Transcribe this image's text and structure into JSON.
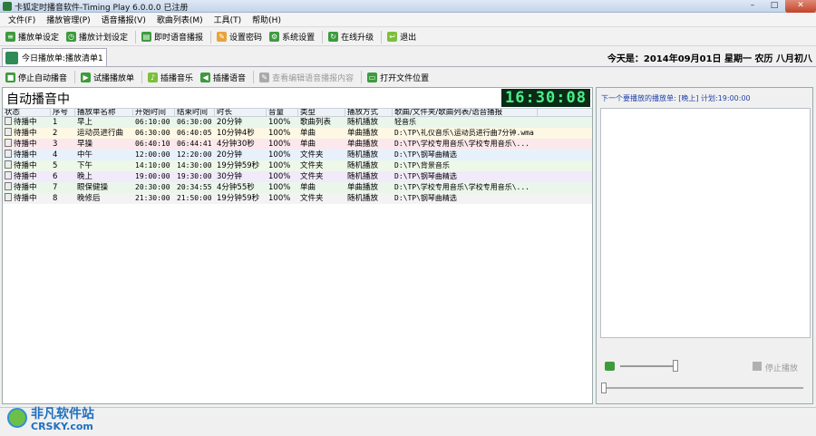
{
  "window": {
    "title": "卡狐定时播音软件-Timing Play 6.0.0.0  已注册"
  },
  "menu": [
    "文件(F)",
    "播放管理(P)",
    "语音播报(V)",
    "歌曲列表(M)",
    "工具(T)",
    "帮助(H)"
  ],
  "toolbar": [
    {
      "label": "播放单设定",
      "icon": "playlist-settings-icon"
    },
    {
      "label": "播放计划设定",
      "icon": "schedule-icon"
    },
    {
      "label": "即时语音播报",
      "icon": "instant-broadcast-icon"
    },
    {
      "label": "设置密码",
      "icon": "password-icon"
    },
    {
      "label": "系统设置",
      "icon": "settings-icon"
    },
    {
      "label": "在线升级",
      "icon": "upgrade-icon"
    },
    {
      "label": "退出",
      "icon": "exit-icon"
    }
  ],
  "tab": {
    "label": "今日播放单:播放清单1"
  },
  "today": "今天是：2014年09月01日  星期一   农历  八月初八",
  "actions": [
    {
      "label": "停止自动播音",
      "enabled": true
    },
    {
      "label": "试播播放单",
      "enabled": true
    },
    {
      "label": "插播音乐",
      "enabled": true
    },
    {
      "label": "插播语音",
      "enabled": true
    },
    {
      "label": "查看编辑语音播报内容",
      "enabled": false
    },
    {
      "label": "打开文件位置",
      "enabled": true
    }
  ],
  "panel": {
    "heading": "自动播音中",
    "clock": "16:30:08"
  },
  "table": {
    "columns": [
      "状态",
      "序号",
      "播放单名称",
      "开始时间",
      "结束时间",
      "时长",
      "音量",
      "类型",
      "播放方式",
      "歌曲/文件夹/歌曲列表/语音播报"
    ],
    "rows": [
      {
        "status": "待播中",
        "no": "1",
        "name": "早上",
        "start": "06:10:00",
        "end": "06:30:00",
        "duration": "20分钟",
        "volume": "100%",
        "type": "歌曲列表",
        "mode": "随机播放",
        "source": "轻音乐",
        "bg": "#eaf6ea"
      },
      {
        "status": "待播中",
        "no": "2",
        "name": "运动员进行曲",
        "start": "06:30:00",
        "end": "06:40:05",
        "duration": "10分钟4秒",
        "volume": "100%",
        "type": "单曲",
        "mode": "单曲播放",
        "source": "D:\\TP\\礼仪音乐\\运动员进行曲7分钟.wma",
        "bg": "#fdf8e4"
      },
      {
        "status": "待播中",
        "no": "3",
        "name": "早操",
        "start": "06:40:10",
        "end": "06:44:41",
        "duration": "4分钟30秒",
        "volume": "100%",
        "type": "单曲",
        "mode": "单曲播放",
        "source": "D:\\TP\\学校专用音乐\\学校专用音乐\\...",
        "bg": "#fbe8ec"
      },
      {
        "status": "待播中",
        "no": "4",
        "name": "中午",
        "start": "12:00:00",
        "end": "12:20:00",
        "duration": "20分钟",
        "volume": "100%",
        "type": "文件夹",
        "mode": "随机播放",
        "source": "D:\\TP\\钢琴曲精选",
        "bg": "#e7f1fb"
      },
      {
        "status": "待播中",
        "no": "5",
        "name": "下午",
        "start": "14:10:00",
        "end": "14:30:00",
        "duration": "19分钟59秒",
        "volume": "100%",
        "type": "文件夹",
        "mode": "随机播放",
        "source": "D:\\TP\\背景音乐",
        "bg": "#edf8e8"
      },
      {
        "status": "待播中",
        "no": "6",
        "name": "晚上",
        "start": "19:00:00",
        "end": "19:30:00",
        "duration": "30分钟",
        "volume": "100%",
        "type": "文件夹",
        "mode": "随机播放",
        "source": "D:\\TP\\钢琴曲精选",
        "bg": "#f1eafa"
      },
      {
        "status": "待播中",
        "no": "7",
        "name": "眼保健操",
        "start": "20:30:00",
        "end": "20:34:55",
        "duration": "4分钟55秒",
        "volume": "100%",
        "type": "单曲",
        "mode": "单曲播放",
        "source": "D:\\TP\\学校专用音乐\\学校专用音乐\\...",
        "bg": "#eaf6ea"
      },
      {
        "status": "待播中",
        "no": "8",
        "name": "晚修后",
        "start": "21:30:00",
        "end": "21:50:00",
        "duration": "19分钟59秒",
        "volume": "100%",
        "type": "文件夹",
        "mode": "随机播放",
        "source": "D:\\TP\\钢琴曲精选",
        "bg": "#f3f3f3"
      }
    ]
  },
  "next": {
    "label": "下一个要播放的播放单: [晚上] 计划:19:00:00"
  },
  "player": {
    "stop_label": "停止播放",
    "volume_level": 0.95,
    "progress": 0.0
  },
  "watermark": {
    "cn": "非凡软件站",
    "en": "CRSKY.com"
  }
}
